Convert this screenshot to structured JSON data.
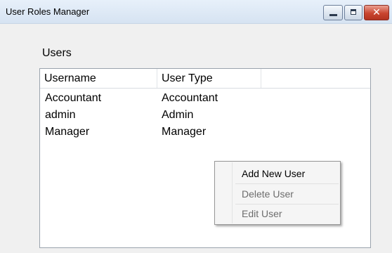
{
  "window": {
    "title": "User Roles Manager",
    "controls": {
      "minimize_icon": "minimize-icon",
      "maximize_icon": "maximize-icon",
      "close_icon": "close-icon",
      "close_glyph": "✕"
    },
    "close_button_color": "#c9452f"
  },
  "users_section": {
    "label": "Users",
    "columns": [
      "Username",
      "User Type"
    ],
    "rows": [
      {
        "username": "Accountant",
        "user_type": "Accountant"
      },
      {
        "username": "admin",
        "user_type": "Admin"
      },
      {
        "username": "Manager",
        "user_type": "Manager"
      }
    ]
  },
  "context_menu": {
    "items": [
      {
        "label": "Add New User",
        "enabled": true
      },
      {
        "label": "Delete User",
        "enabled": false
      },
      {
        "label": "Edit User",
        "enabled": false
      }
    ],
    "enabled_color": "#000000",
    "disabled_color": "#6d6d6d"
  }
}
